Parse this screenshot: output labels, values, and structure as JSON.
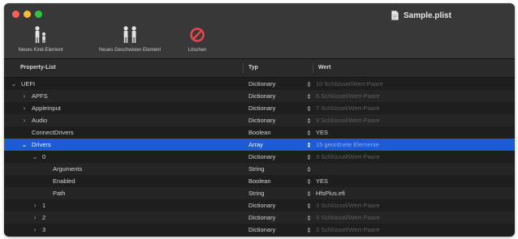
{
  "window": {
    "title": "Sample.plist",
    "colors": {
      "close": "#ff5f57",
      "minimize": "#febc2e",
      "maximize": "#28c840",
      "selection": "#1a5bd6"
    }
  },
  "toolbar": {
    "items": [
      {
        "label": "Neues Kind-Element",
        "icon": "add-child-icon"
      },
      {
        "label": "Neues Geschwister-Element",
        "icon": "add-sibling-icon"
      },
      {
        "label": "Löschen",
        "icon": "delete-icon"
      }
    ]
  },
  "columns": {
    "key": "Property-List",
    "type": "Typ",
    "value": "Wert"
  },
  "rows": [
    {
      "key": "UEFI",
      "type": "Dictionary",
      "value": "10 Schlüssel/Wert-Paare",
      "level": 1,
      "disclosure": "expanded",
      "muted": true
    },
    {
      "key": "APFS",
      "type": "Dictionary",
      "value": "6 Schlüssel/Wert-Paare",
      "level": 2,
      "disclosure": "collapsed",
      "muted": true
    },
    {
      "key": "AppleInput",
      "type": "Dictionary",
      "value": "7 Schlüssel/Wert-Paare",
      "level": 2,
      "disclosure": "collapsed",
      "muted": true
    },
    {
      "key": "Audio",
      "type": "Dictionary",
      "value": "9 Schlüssel/Wert-Paare",
      "level": 2,
      "disclosure": "collapsed",
      "muted": true
    },
    {
      "key": "ConnectDrivers",
      "type": "Boolean",
      "value": "YES",
      "level": 2,
      "disclosure": "none",
      "muted": false
    },
    {
      "key": "Drivers",
      "type": "Array",
      "value": "15 geordnete Elemente",
      "level": 2,
      "disclosure": "expanded",
      "muted": true,
      "selected": true
    },
    {
      "key": "0",
      "type": "Dictionary",
      "value": "3 Schlüssel/Wert-Paare",
      "level": 3,
      "disclosure": "expanded",
      "muted": true
    },
    {
      "key": "Arguments",
      "type": "String",
      "value": "",
      "level": 4,
      "disclosure": "none",
      "muted": false
    },
    {
      "key": "Enabled",
      "type": "Boolean",
      "value": "YES",
      "level": 4,
      "disclosure": "none",
      "muted": false
    },
    {
      "key": "Path",
      "type": "String",
      "value": "HfsPlus.efi",
      "level": 4,
      "disclosure": "none",
      "muted": false
    },
    {
      "key": "1",
      "type": "Dictionary",
      "value": "3 Schlüssel/Wert-Paare",
      "level": 3,
      "disclosure": "collapsed",
      "muted": true
    },
    {
      "key": "2",
      "type": "Dictionary",
      "value": "3 Schlüssel/Wert-Paare",
      "level": 3,
      "disclosure": "collapsed",
      "muted": true
    },
    {
      "key": "3",
      "type": "Dictionary",
      "value": "3 Schlüssel/Wert-Paare",
      "level": 3,
      "disclosure": "collapsed",
      "muted": true
    }
  ]
}
